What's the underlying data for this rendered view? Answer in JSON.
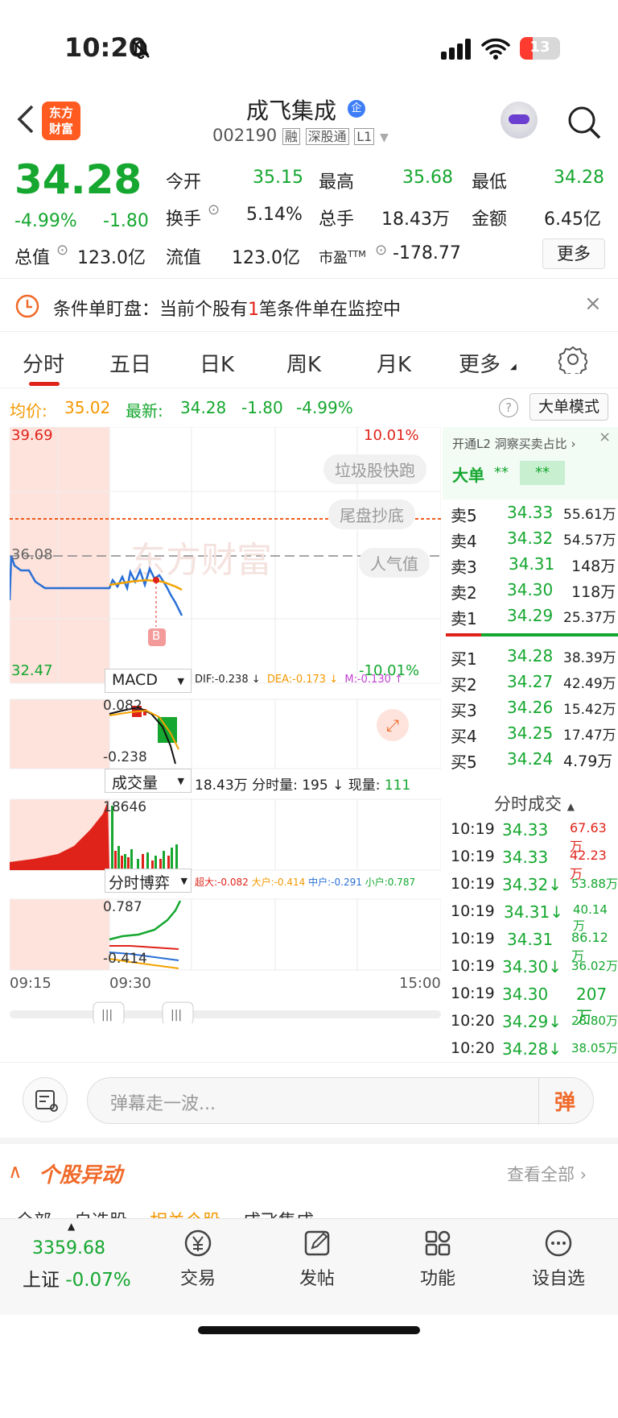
{
  "status_bar": {
    "time": "10:20",
    "battery": "13"
  },
  "header": {
    "logo_text_1": "东方",
    "logo_text_2": "财富",
    "stock_name": "成飞集成",
    "code": "002190",
    "tag_rong": "融",
    "tag_sgt": "深股通",
    "tag_level": "L1",
    "badge": "企"
  },
  "quote": {
    "price": "34.28",
    "pct": "-4.99%",
    "chg": "-1.80",
    "open_label": "今开",
    "open": "35.15",
    "high_label": "最高",
    "high": "35.68",
    "low_label": "最低",
    "low": "34.28",
    "turnover_label": "换手",
    "turnover": "5.14%",
    "vol_label": "总手",
    "vol": "18.43万",
    "amount_label": "金额",
    "amount": "6.45亿",
    "mktcap_label": "总值",
    "mktcap": "123.0亿",
    "float_label": "流值",
    "float": "123.0亿",
    "pe_label": "市盈",
    "pe_sup": "TTM",
    "pe": "-178.77",
    "more_button": "更多"
  },
  "banner": {
    "prefix": "条件单盯盘：当前个股有",
    "count": "1",
    "suffix": "笔条件单在监控中"
  },
  "tabs": [
    "分时",
    "五日",
    "日K",
    "周K",
    "月K",
    "更多"
  ],
  "info": {
    "avg_label": "均价:",
    "avg": "35.02",
    "latest_label": "最新:",
    "latest": "34.28",
    "chg": "-1.80",
    "pct": "-4.99%",
    "mode_button": "大单模式"
  },
  "chart": {
    "y_top": "39.69",
    "y_mid": "36.08",
    "y_bottom": "32.47",
    "pct_top": "10.01%",
    "pct_bottom": "-10.01%",
    "tags": [
      "垃圾股快跑",
      "尾盘抄底",
      "人气值"
    ],
    "marker": "B",
    "watermark": "东方财富",
    "macd_label": "MACD",
    "dif": "DIF:-0.238 ↓",
    "dea": "DEA:-0.173 ↓",
    "m": "M:-0.130 ↑",
    "macd_top": "0.082",
    "macd_bottom": "-0.238",
    "vol_label": "成交量",
    "vol_total": "18.43万",
    "vol_period": "分时量: 195 ↓",
    "vol_now_label": "现量:",
    "vol_now": "111",
    "vol_max": "18646",
    "game_label": "分时博弈",
    "super": "超大:-0.082",
    "big": "大户:-0.414",
    "mid": "中户:-0.291",
    "small": "小户:0.787",
    "game_top": "0.787",
    "game_bottom": "-0.414",
    "t_start": "09:15",
    "t_open": "09:30",
    "t_end": "15:00"
  },
  "right": {
    "title": "开通L2 洞察买卖占比",
    "big_label": "大单",
    "big_sell": "**",
    "big_buy": "**",
    "asks": [
      {
        "label": "卖5",
        "price": "34.33",
        "vol": "55.61万"
      },
      {
        "label": "卖4",
        "price": "34.32",
        "vol": "54.57万"
      },
      {
        "label": "卖3",
        "price": "34.31",
        "vol": "148万"
      },
      {
        "label": "卖2",
        "price": "34.30",
        "vol": "118万"
      },
      {
        "label": "卖1",
        "price": "34.29",
        "vol": "25.37万"
      }
    ],
    "bids": [
      {
        "label": "买1",
        "price": "34.28",
        "vol": "38.39万"
      },
      {
        "label": "买2",
        "price": "34.27",
        "vol": "42.49万"
      },
      {
        "label": "买3",
        "price": "34.26",
        "vol": "15.42万"
      },
      {
        "label": "买4",
        "price": "34.25",
        "vol": "17.47万"
      },
      {
        "label": "买5",
        "price": "34.24",
        "vol": "4.79万"
      }
    ],
    "trades_title": "分时成交",
    "trades": [
      {
        "t": "10:19",
        "p": "34.33",
        "v": "67.63万",
        "c": "red"
      },
      {
        "t": "10:19",
        "p": "34.33",
        "v": "42.23万",
        "c": "red"
      },
      {
        "t": "10:19",
        "p": "34.32↓",
        "v": "53.88万",
        "c": "green"
      },
      {
        "t": "10:19",
        "p": "34.31↓",
        "v": "40.14万",
        "c": "green"
      },
      {
        "t": "10:19",
        "p": "34.31",
        "v": "86.12万",
        "c": "green"
      },
      {
        "t": "10:19",
        "p": "34.30↓",
        "v": "36.02万",
        "c": "green"
      },
      {
        "t": "10:19",
        "p": "34.30",
        "v": "207万",
        "c": "green"
      },
      {
        "t": "10:20",
        "p": "34.29↓",
        "v": "28.80万",
        "c": "green"
      },
      {
        "t": "10:20",
        "p": "34.28↓",
        "v": "38.05万",
        "c": "green"
      }
    ]
  },
  "comment": {
    "placeholder": "弹幕走一波...",
    "send": "弹"
  },
  "movers": {
    "title": "个股异动",
    "view_all": "查看全部",
    "subtabs": [
      "全部",
      "自选股",
      "相关个股",
      "成飞集成"
    ]
  },
  "bottom_nav": {
    "index_value": "3359.68",
    "index_name": "上证",
    "index_pct": "-0.07%",
    "items": [
      "交易",
      "发帖",
      "功能",
      "设自选"
    ]
  }
}
